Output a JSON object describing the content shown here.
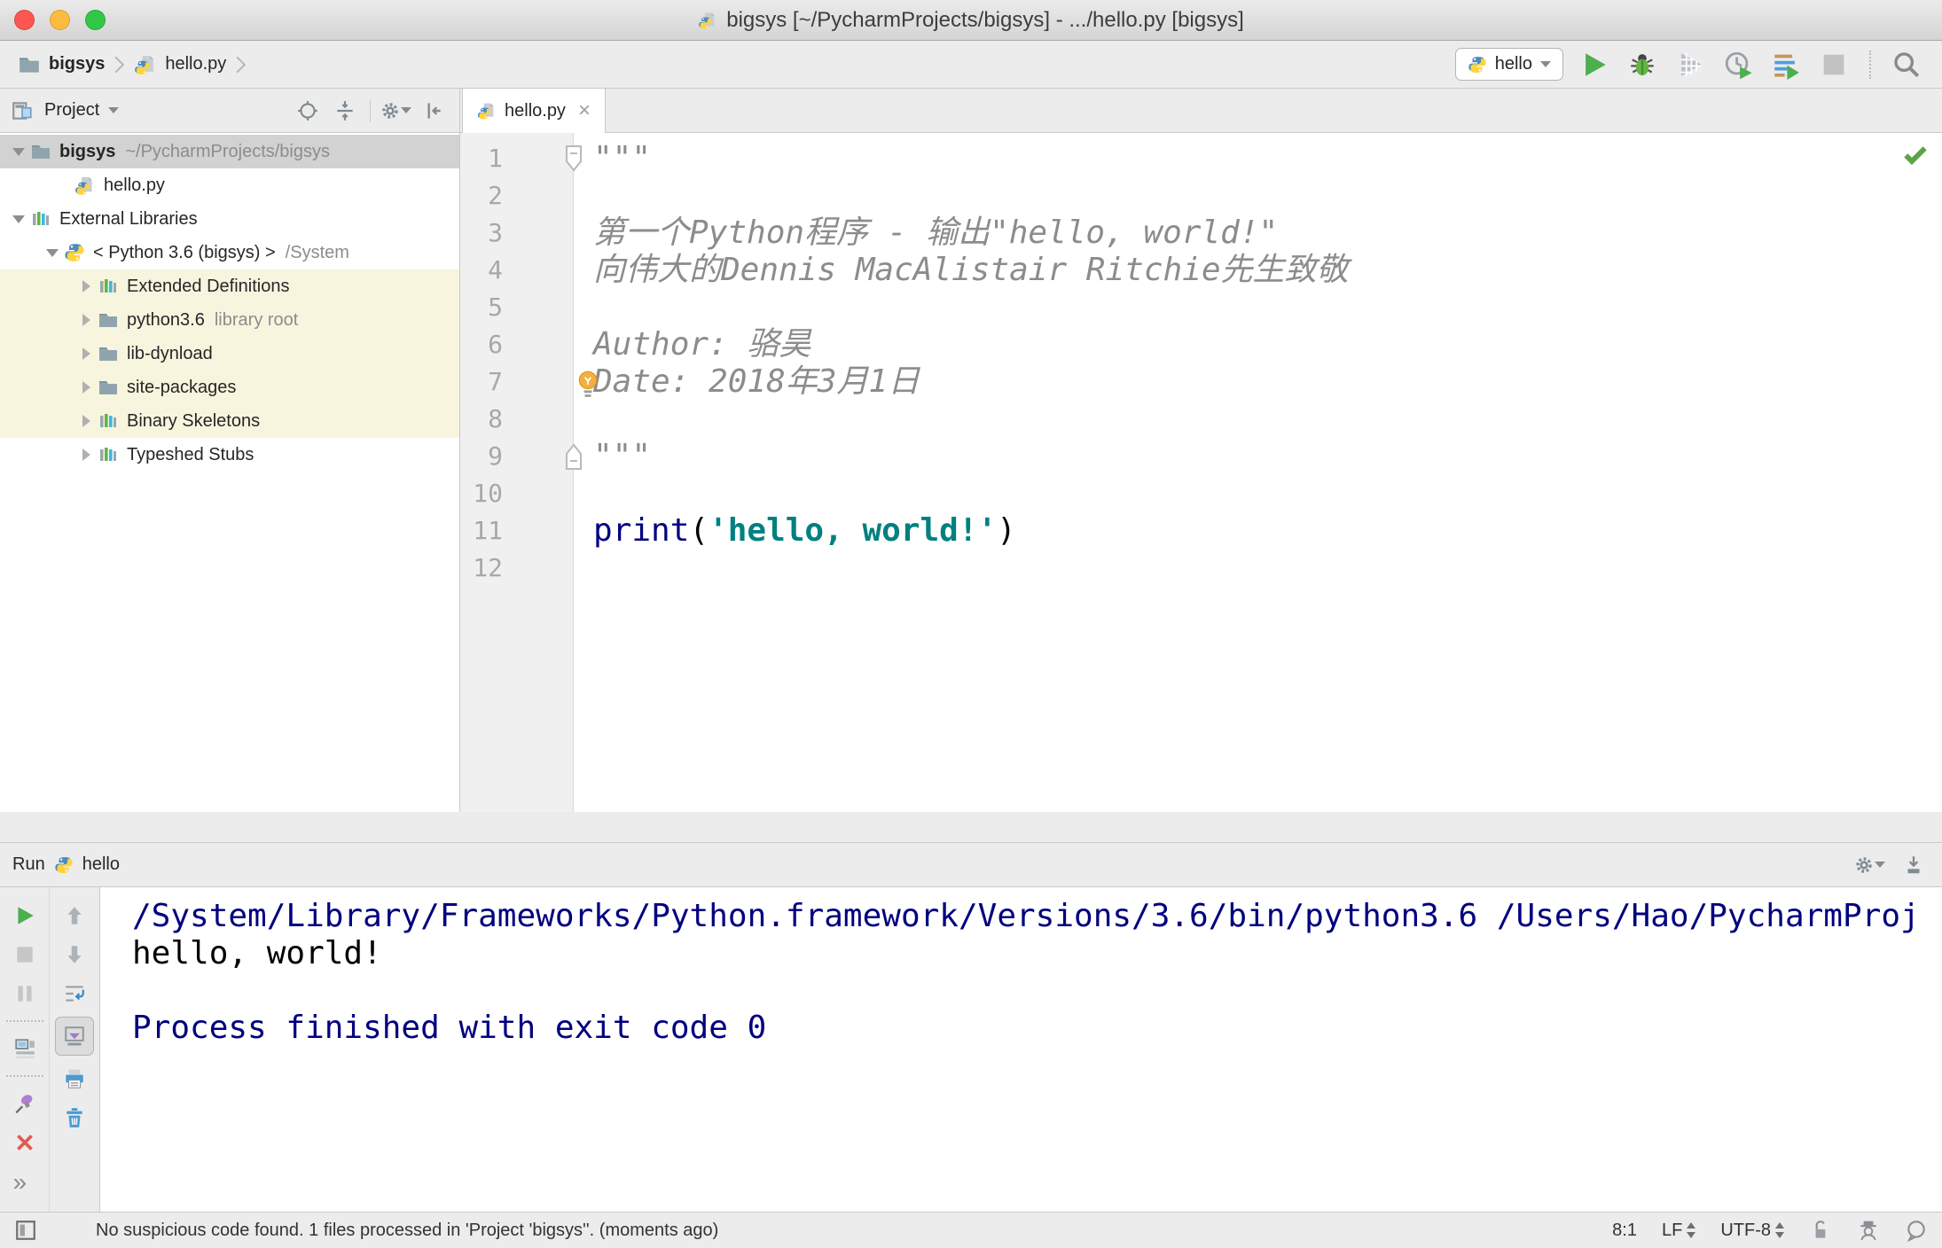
{
  "window": {
    "title": "bigsys [~/PycharmProjects/bigsys] - .../hello.py [bigsys]",
    "title_icon": "python-file"
  },
  "navbar": {
    "breadcrumbs": [
      {
        "label": "bigsys",
        "icon": "folder",
        "bold": true
      },
      {
        "label": "hello.py",
        "icon": "python-file",
        "bold": false
      }
    ],
    "run_config": {
      "label": "hello",
      "icon": "python-logo"
    },
    "actions": [
      {
        "name": "run",
        "icon": "run-play",
        "enabled": true
      },
      {
        "name": "debug",
        "icon": "debug-bug",
        "enabled": true
      },
      {
        "name": "run-with-coverage",
        "icon": "coverage",
        "enabled": true
      },
      {
        "name": "profiler",
        "icon": "profiler",
        "enabled": true
      },
      {
        "name": "concurrency-diagram",
        "icon": "run-configs",
        "enabled": true
      },
      {
        "name": "stop",
        "icon": "stop-square",
        "enabled": false
      },
      {
        "name": "separator"
      },
      {
        "name": "search-everywhere",
        "icon": "search",
        "enabled": true
      }
    ]
  },
  "project_panel": {
    "title": "Project",
    "title_icon": "project-tool",
    "actions": [
      {
        "name": "locate-file",
        "icon": "target"
      },
      {
        "name": "collapse-all",
        "icon": "collapse-all"
      },
      {
        "name": "separator"
      },
      {
        "name": "settings",
        "icon": "gear",
        "caret": true
      },
      {
        "name": "hide-panel",
        "icon": "hide-left"
      }
    ],
    "tree": [
      {
        "label": "bigsys",
        "suffix": "~/PycharmProjects/bigsys",
        "icon": "folder",
        "level": 0,
        "expander": "open",
        "bold": true,
        "selected": true
      },
      {
        "label": "hello.py",
        "icon": "python-file",
        "level": 2,
        "expander": null
      },
      {
        "label": "External Libraries",
        "icon": "library",
        "level": 0,
        "expander": "open"
      },
      {
        "label": "< Python 3.6 (bigsys) >",
        "suffix": "/System",
        "icon": "python-logo",
        "level": 1,
        "expander": "open"
      },
      {
        "label": "Extended Definitions",
        "icon": "library",
        "level": 2,
        "expander": "closed",
        "highlight": true
      },
      {
        "label": "python3.6",
        "suffix": "library root",
        "icon": "folder",
        "level": 2,
        "expander": "closed",
        "highlight": true
      },
      {
        "label": "lib-dynload",
        "icon": "folder",
        "level": 2,
        "expander": "closed",
        "highlight": true
      },
      {
        "label": "site-packages",
        "icon": "folder",
        "level": 2,
        "expander": "closed",
        "highlight": true
      },
      {
        "label": "Binary Skeletons",
        "icon": "library",
        "level": 2,
        "expander": "closed",
        "highlight": true
      },
      {
        "label": "Typeshed Stubs",
        "icon": "library",
        "level": 2,
        "expander": "closed"
      }
    ]
  },
  "editor": {
    "tab": "hello.py",
    "tab_icon": "python-file",
    "inspection_status_icon": "check",
    "lines": [
      {
        "n": 1,
        "fold": "start",
        "segments": [
          {
            "t": "\"\"\"",
            "c": "doc"
          }
        ]
      },
      {
        "n": 2,
        "segments": []
      },
      {
        "n": 3,
        "segments": [
          {
            "t": "第一个Python程序 - 输出\"hello, world!\"",
            "c": "doc"
          }
        ]
      },
      {
        "n": 4,
        "segments": [
          {
            "t": "向伟大的Dennis MacAlistair Ritchie先生致敬",
            "c": "doc"
          }
        ]
      },
      {
        "n": 5,
        "segments": []
      },
      {
        "n": 6,
        "segments": [
          {
            "t": "Author: 骆昊",
            "c": "doc"
          }
        ]
      },
      {
        "n": 7,
        "bulb": true,
        "segments": [
          {
            "t": "Date: 2018年3月1日",
            "c": "doc"
          }
        ]
      },
      {
        "n": 8,
        "current": true,
        "segments": []
      },
      {
        "n": 9,
        "fold": "end",
        "segments": [
          {
            "t": "\"\"\"",
            "c": "doc"
          }
        ]
      },
      {
        "n": 10,
        "segments": []
      },
      {
        "n": 11,
        "segments": [
          {
            "t": "print",
            "c": "kw"
          },
          {
            "t": "(",
            "c": "pl"
          },
          {
            "t": "'hello, world!'",
            "c": "str"
          },
          {
            "t": ")",
            "c": "pl"
          }
        ]
      },
      {
        "n": 12,
        "segments": []
      }
    ]
  },
  "run_panel": {
    "title": "Run",
    "config": "hello",
    "config_icon": "python-logo",
    "header_actions": [
      {
        "name": "settings",
        "icon": "gear",
        "caret": true
      },
      {
        "name": "dock",
        "icon": "dock-down"
      }
    ],
    "toolbar_left": [
      {
        "name": "rerun",
        "icon": "run-play",
        "enabled": true
      },
      {
        "name": "stop",
        "icon": "stop-square",
        "enabled": false
      },
      {
        "name": "pause-output",
        "icon": "pause",
        "enabled": false
      },
      {
        "name": "separator"
      },
      {
        "name": "restore-layout",
        "icon": "layout",
        "enabled": true
      },
      {
        "name": "separator"
      },
      {
        "name": "pin-tab",
        "icon": "pin",
        "enabled": true
      },
      {
        "name": "close",
        "icon": "close-red",
        "enabled": true
      },
      {
        "name": "more",
        "icon": "more-chevrons",
        "enabled": true
      }
    ],
    "toolbar_right": [
      {
        "name": "up-stacktrace",
        "icon": "arrow-up",
        "enabled": false
      },
      {
        "name": "down-stacktrace",
        "icon": "arrow-down",
        "enabled": false
      },
      {
        "name": "soft-wrap",
        "icon": "soft-wrap",
        "enabled": true
      },
      {
        "name": "scroll-to-end",
        "icon": "scroll-end",
        "enabled": true,
        "selected": true
      },
      {
        "name": "print",
        "icon": "printer",
        "enabled": true
      },
      {
        "name": "clear-all",
        "icon": "trash",
        "enabled": true
      }
    ],
    "console": [
      {
        "text": "/System/Library/Frameworks/Python.framework/Versions/3.6/bin/python3.6 /Users/Hao/PycharmProj",
        "kind": "sys"
      },
      {
        "text": "hello, world!",
        "kind": "out"
      },
      {
        "text": "",
        "kind": "out"
      },
      {
        "text": "Process finished with exit code 0",
        "kind": "sys"
      }
    ]
  },
  "status_bar": {
    "message": "No suspicious code found. 1 files processed in 'Project 'bigsys''. (moments ago)",
    "position": "8:1",
    "line_ending": "LF",
    "encoding": "UTF-8"
  }
}
